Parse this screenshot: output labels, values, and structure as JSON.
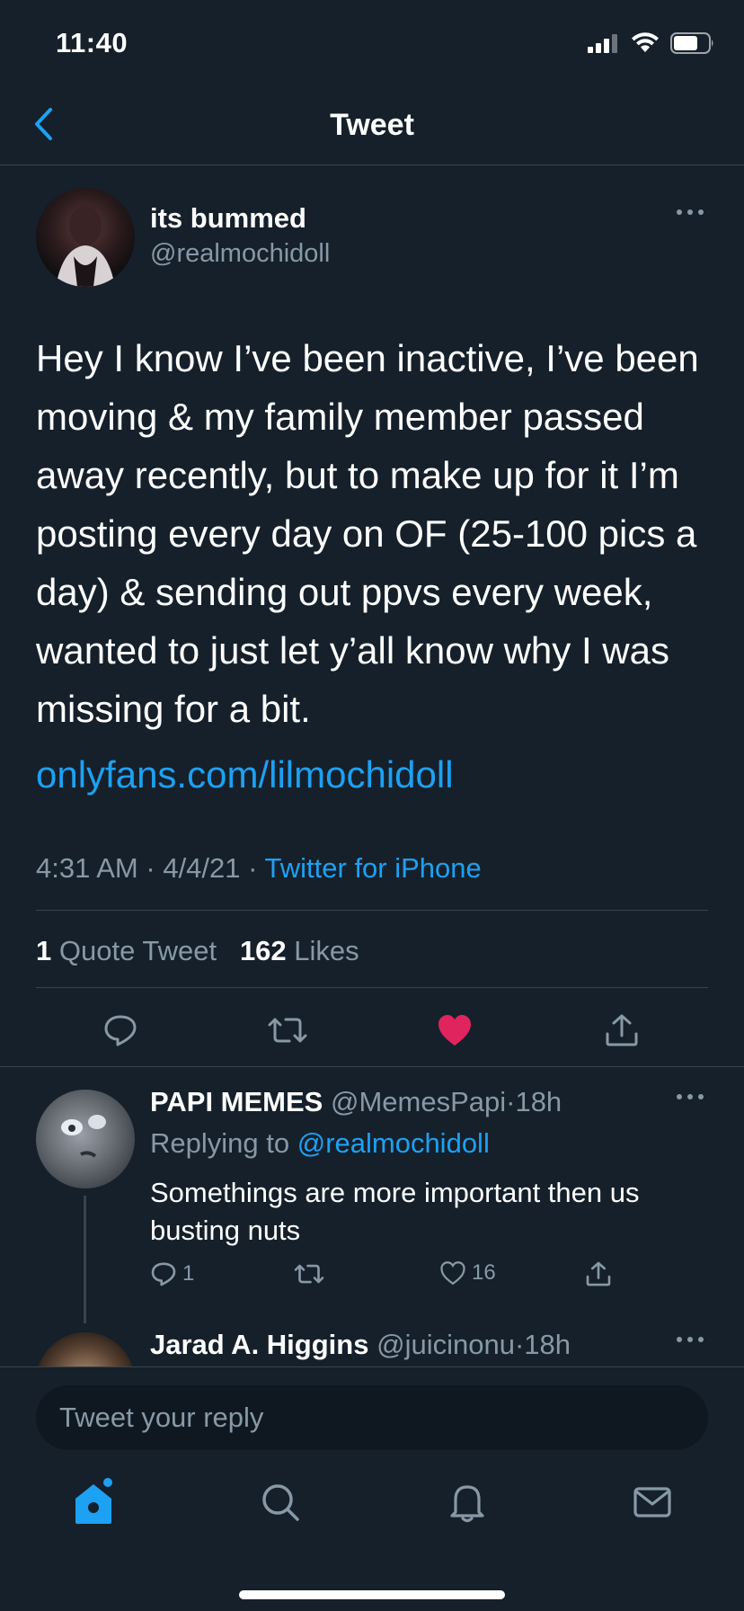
{
  "status_bar": {
    "time": "11:40"
  },
  "nav": {
    "title": "Tweet"
  },
  "tweet": {
    "author_name": "its bummed",
    "author_handle": "@realmochidoll",
    "text": "Hey I know I’ve been inactive, I’ve been moving & my family member passed away recently, but to make up for it I’m posting every day on OF (25-100 pics a day) & sending out ppvs every week, wanted to just let y’all know why I was missing for a bit.",
    "link": "onlyfans.com/lilmochidoll",
    "time": "4:31 AM",
    "date": "4/4/21",
    "separator": "·",
    "source": "Twitter for iPhone",
    "quote_count": "1",
    "quote_label": "Quote Tweet",
    "like_count": "162",
    "like_label": "Likes",
    "liked": true,
    "like_color": "#e0245e"
  },
  "replies": [
    {
      "name": "PAPI MEMES",
      "handle": "@MemesPapi",
      "age": "18h",
      "replying_prefix": "Replying to",
      "replying_to": "@realmochidoll",
      "text": "Somethings are more important then us busting nuts",
      "reply_count": "1",
      "like_count": "16"
    },
    {
      "name": "Jarad A. Higgins",
      "handle": "@juicinonu",
      "age": "18h"
    }
  ],
  "composer": {
    "placeholder": "Tweet your reply"
  },
  "tabbar": {
    "items": [
      "home-icon",
      "search-icon",
      "notifications-icon",
      "messages-icon"
    ],
    "active": "home-icon"
  },
  "colors": {
    "background": "#15202b",
    "accent": "#1da1f2",
    "muted": "#8899a6",
    "divider": "#38444d"
  }
}
